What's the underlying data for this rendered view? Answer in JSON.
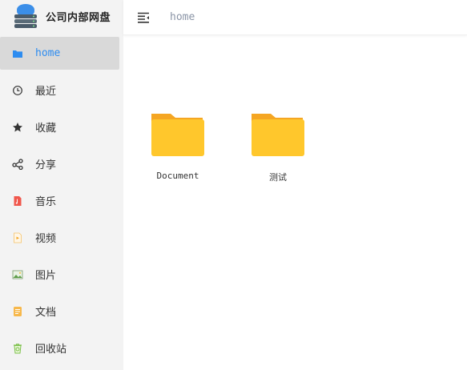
{
  "app": {
    "title": "公司内部网盘",
    "logo_icon": "cloud-server-icon"
  },
  "header": {
    "menu_icon": "menu-fold-icon",
    "breadcrumb": "home"
  },
  "colors": {
    "accent": "#2d8cf0",
    "folder": "#ffc72c",
    "folder_tab": "#f5a623",
    "sidebar_bg": "#f3f3f3",
    "active_bg": "#d9d9d9"
  },
  "sidebar": {
    "items": [
      {
        "label": "home",
        "icon": "folder-icon",
        "active": true
      },
      {
        "label": "最近",
        "icon": "clock-icon"
      },
      {
        "label": "收藏",
        "icon": "star-icon"
      },
      {
        "label": "分享",
        "icon": "share-icon"
      },
      {
        "label": "音乐",
        "icon": "music-file-icon"
      },
      {
        "label": "视频",
        "icon": "video-file-icon"
      },
      {
        "label": "图片",
        "icon": "image-icon"
      },
      {
        "label": "文档",
        "icon": "document-icon"
      },
      {
        "label": "回收站",
        "icon": "recycle-bin-icon"
      }
    ]
  },
  "main": {
    "files": [
      {
        "name": "Document",
        "type": "folder"
      },
      {
        "name": "测试",
        "type": "folder"
      }
    ]
  }
}
